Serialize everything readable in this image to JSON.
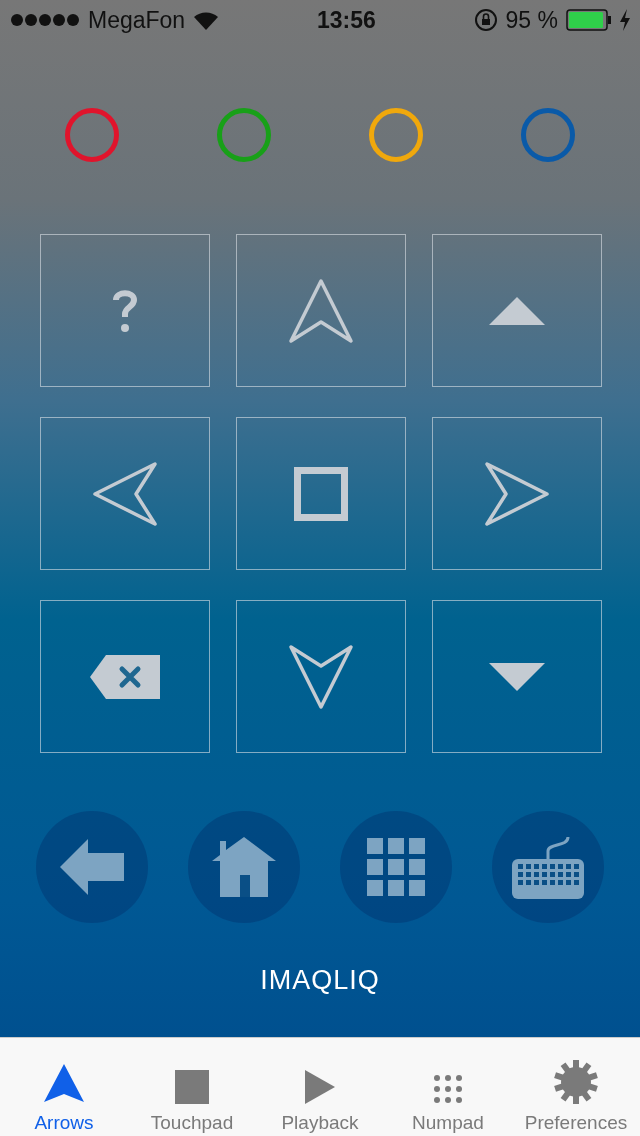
{
  "status_bar": {
    "carrier": "MegaFon",
    "time": "13:56",
    "battery": "95 %"
  },
  "color_buttons": [
    {
      "color": "#e0142c"
    },
    {
      "color": "#18a018"
    },
    {
      "color": "#f0a80c"
    },
    {
      "color": "#0a5aa8"
    }
  ],
  "keypad": [
    {
      "kind": "help"
    },
    {
      "kind": "arrow-up"
    },
    {
      "kind": "page-up"
    },
    {
      "kind": "arrow-left"
    },
    {
      "kind": "ok"
    },
    {
      "kind": "arrow-right"
    },
    {
      "kind": "backspace"
    },
    {
      "kind": "arrow-down"
    },
    {
      "kind": "page-down"
    }
  ],
  "round_buttons": [
    {
      "kind": "back"
    },
    {
      "kind": "home"
    },
    {
      "kind": "apps"
    },
    {
      "kind": "keyboard"
    }
  ],
  "brand": "IMAQLIQ",
  "tabs": [
    {
      "label": "Arrows",
      "kind": "arrows",
      "selected": true
    },
    {
      "label": "Touchpad",
      "kind": "touchpad",
      "selected": false
    },
    {
      "label": "Playback",
      "kind": "playback",
      "selected": false
    },
    {
      "label": "Numpad",
      "kind": "numpad",
      "selected": false
    },
    {
      "label": "Preferences",
      "kind": "preferences",
      "selected": false
    }
  ]
}
